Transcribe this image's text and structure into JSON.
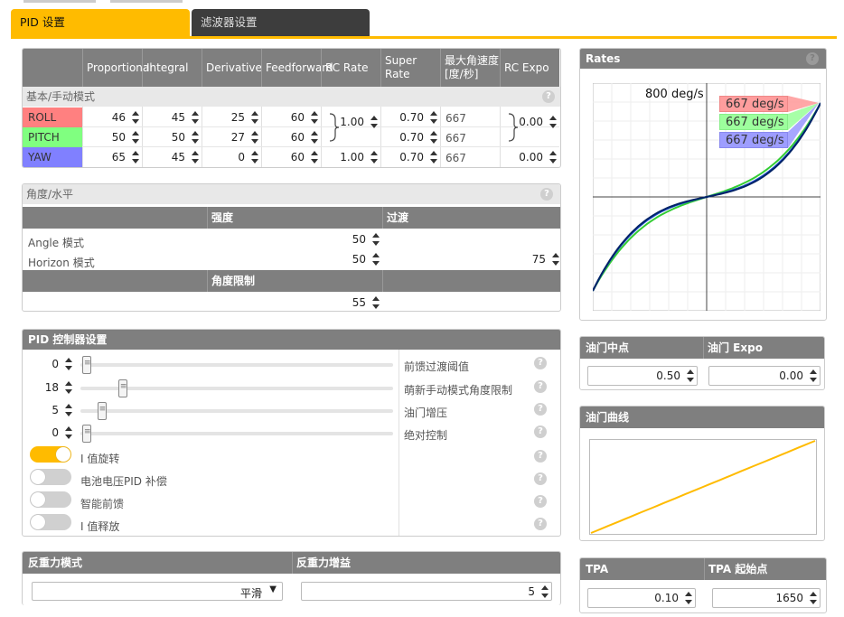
{
  "tabs": [
    {
      "label": "PID 设置",
      "active": true
    },
    {
      "label": "滤波器设置",
      "active": false
    }
  ],
  "pid_table": {
    "headers": [
      "Proportional",
      "Integral",
      "Derivative",
      "Feedforward",
      "RC Rate",
      "Super Rate",
      "最大角速度 [度/秒]",
      "RC Expo"
    ],
    "section_label": "基本/手动模式",
    "rows": [
      {
        "axis": "ROLL",
        "color": "#ff8080",
        "p": "46",
        "i": "45",
        "d": "25",
        "ff": "60",
        "super_rate": "0.70",
        "max_rate": "667"
      },
      {
        "axis": "PITCH",
        "color": "#80ff80",
        "p": "50",
        "i": "50",
        "d": "27",
        "ff": "60",
        "super_rate": "0.70",
        "max_rate": "667"
      },
      {
        "axis": "YAW",
        "color": "#8080ff",
        "p": "65",
        "i": "45",
        "d": "0",
        "ff": "60",
        "rc_rate": "1.00",
        "super_rate": "0.70",
        "max_rate": "667",
        "rc_expo": "0.00"
      }
    ],
    "roll_pitch_rc_rate": "1.00",
    "roll_pitch_rc_expo": "0.00"
  },
  "angle_horizon": {
    "title": "角度/水平",
    "col_strength": "强度",
    "col_transition": "过渡",
    "angle_label": "Angle 模式",
    "angle_strength": "50",
    "horizon_label": "Horizon 模式",
    "horizon_strength": "50",
    "horizon_transition": "75",
    "angle_limit_label": "角度限制",
    "angle_limit": "55"
  },
  "pid_controller": {
    "title": "PID 控制器设置",
    "sliders": [
      {
        "value": "0",
        "label": "前馈过渡阈值",
        "level": 0.0
      },
      {
        "value": "18",
        "label": "萌新手动模式角度限制",
        "level": 0.12
      },
      {
        "value": "5",
        "label": "油门增压",
        "level": 0.05
      },
      {
        "value": "0",
        "label": "绝对控制",
        "level": 0.0
      }
    ],
    "toggles": [
      {
        "label": "I 值旋转",
        "on": true
      },
      {
        "label": "电池电压PID 补偿",
        "on": false
      },
      {
        "label": "智能前馈",
        "on": false
      },
      {
        "label": "I 值释放",
        "on": false
      }
    ]
  },
  "anti_gravity": {
    "mode_label": "反重力模式",
    "mode_value": "平滑",
    "gain_label": "反重力增益",
    "gain_value": "5"
  },
  "rates": {
    "title": "Rates",
    "max_label": "800 deg/s",
    "legend": [
      {
        "text": "667 deg/s",
        "color": "#ff9d9d"
      },
      {
        "text": "667 deg/s",
        "color": "#9dff9d"
      },
      {
        "text": "667 deg/s",
        "color": "#9d9dff"
      }
    ]
  },
  "throttle": {
    "mid_label": "油门中点",
    "mid_value": "0.50",
    "expo_label": "油门 Expo",
    "expo_value": "0.00",
    "curve_title": "油门曲线",
    "curve_color": "#ffbb00"
  },
  "tpa": {
    "tpa_label": "TPA",
    "tpa_value": "0.10",
    "breakpoint_label": "TPA 起始点",
    "breakpoint_value": "1650"
  },
  "help_icon": "?"
}
